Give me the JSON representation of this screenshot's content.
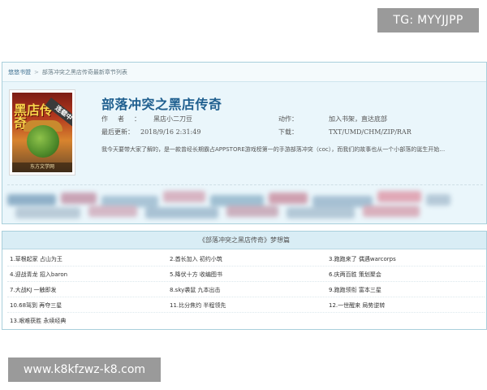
{
  "watermarks": {
    "top_right": "TG: MYYJJPP",
    "bottom_left": "www.k8kfzwz-k8.com"
  },
  "breadcrumb": {
    "home": "悠悠书盟",
    "separator": ">",
    "current": "部落冲突之黑店传奇最新章节列表"
  },
  "cover": {
    "title": "黑店传奇",
    "ribbon": "连载中",
    "footer": "东方文学网"
  },
  "book": {
    "title": "部落冲突之黑店传奇",
    "author_label": "作者：",
    "author": "黑店小二刀豆",
    "action_label": "动作：",
    "action": "加入书架，直达底部",
    "update_label": "最后更新：",
    "update": "2018/9/16 2:31:49",
    "download_label": "下载：",
    "download": "TXT/UMD/CHM/ZIP/RAR",
    "intro": "我今天要带大家了解的，是一款曾经长期霸占APPSTORE游戏榜第一的手游部落冲突（coc），而我们的故事也从一个小部落的诞生开始…"
  },
  "chapters": {
    "header": "《部落冲突之黑店传奇》梦想篇",
    "rows": [
      [
        "1.草根起家  占山为王",
        "2.酋长加入  初约小筑",
        "3.跑跑来了  偶遇warcorps"
      ],
      [
        "4.迎战青龙  招入baron",
        "5.降伏十方  收编图书",
        "6.庆两百胜  策划聚会"
      ],
      [
        "7.大战KJ  一触即发",
        "8.sky袭鼠  九本出击",
        "9.跑跑领衔  富本三星"
      ],
      [
        "10.68驾到  再夺三星",
        "11.比分焦灼  半程领先",
        "12.一世醒来  局势逆转"
      ],
      [
        "13.艰难获胜  永续经典",
        "",
        ""
      ]
    ]
  },
  "colors": {
    "title": "#1f5f8f",
    "panel_border": "#a9cfdb",
    "panel_bg": "#eaf6fb",
    "watermark_bg": "#9a9a9a"
  }
}
